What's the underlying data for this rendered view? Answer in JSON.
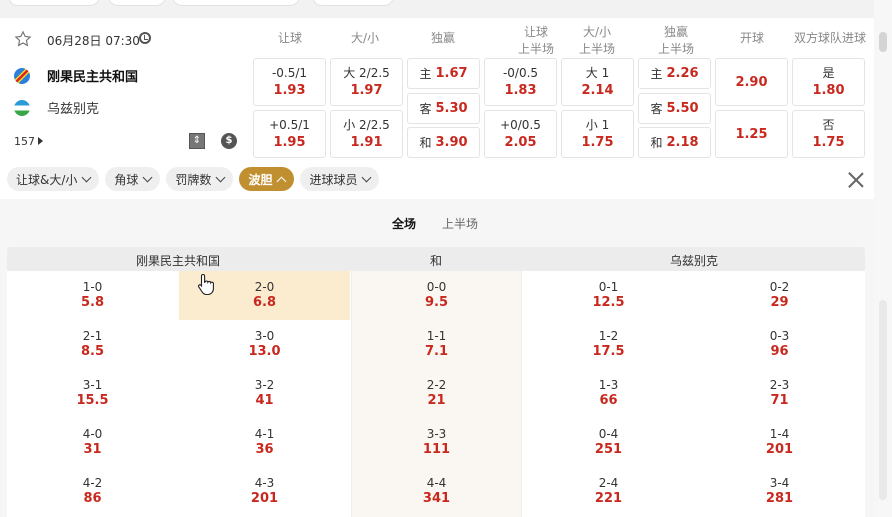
{
  "match": {
    "datetime": "06月28日 07:30",
    "home": "刚果民主共和国",
    "away": "乌兹别克",
    "more_count": "157"
  },
  "icons": {
    "star": "star-outline-icon",
    "clock": "clock-icon",
    "stats": "stats-icon",
    "dollar": "dollar-icon",
    "close": "close-icon"
  },
  "columns": {
    "handicap": "让球",
    "total": "大/小",
    "moneyline": "独赢",
    "handicap_half": "让球\n上半场",
    "total_half": "大/小\n上半场",
    "moneyline_half": "独赢\n上半场",
    "first_goal": "开球",
    "btts": "双方球队进球"
  },
  "odds": {
    "handicap": [
      {
        "line": "-0.5/1",
        "odd": "1.93"
      },
      {
        "line": "+0.5/1",
        "odd": "1.95"
      }
    ],
    "total": [
      {
        "line": "大 2/2.5",
        "odd": "1.97"
      },
      {
        "line": "小 2/2.5",
        "odd": "1.91"
      }
    ],
    "moneyline": [
      {
        "line": "主",
        "odd": "1.67"
      },
      {
        "line": "客",
        "odd": "5.30"
      },
      {
        "line": "和",
        "odd": "3.90"
      }
    ],
    "handicap_half": [
      {
        "line": "-0/0.5",
        "odd": "1.83"
      },
      {
        "line": "+0/0.5",
        "odd": "2.05"
      }
    ],
    "total_half": [
      {
        "line": "大 1",
        "odd": "2.14"
      },
      {
        "line": "小 1",
        "odd": "1.75"
      }
    ],
    "moneyline_half": [
      {
        "line": "主",
        "odd": "2.26"
      },
      {
        "line": "客",
        "odd": "5.50"
      },
      {
        "line": "和",
        "odd": "2.18"
      }
    ],
    "first_goal": [
      {
        "odd": "2.90"
      },
      {
        "odd": "1.25"
      }
    ],
    "btts": [
      {
        "line": "是",
        "odd": "1.80"
      },
      {
        "line": "否",
        "odd": "1.75"
      }
    ]
  },
  "filters": [
    {
      "label": "让球&大/小",
      "active": false
    },
    {
      "label": "角球",
      "active": false
    },
    {
      "label": "罚牌数",
      "active": false
    },
    {
      "label": "波胆",
      "active": true
    },
    {
      "label": "进球球员",
      "active": false
    }
  ],
  "period_tabs": [
    {
      "label": "全场",
      "active": true
    },
    {
      "label": "上半场",
      "active": false
    }
  ],
  "score_headers": {
    "home": "刚果民主共和国",
    "draw": "和",
    "away": "乌兹别克"
  },
  "scores": {
    "home_a": [
      {
        "s": "1-0",
        "o": "5.8"
      },
      {
        "s": "2-1",
        "o": "8.5"
      },
      {
        "s": "3-1",
        "o": "15.5"
      },
      {
        "s": "4-0",
        "o": "31"
      },
      {
        "s": "4-2",
        "o": "86"
      }
    ],
    "home_b": [
      {
        "s": "2-0",
        "o": "6.8"
      },
      {
        "s": "3-0",
        "o": "13.0"
      },
      {
        "s": "3-2",
        "o": "41"
      },
      {
        "s": "4-1",
        "o": "36"
      },
      {
        "s": "4-3",
        "o": "201"
      }
    ],
    "draw": [
      {
        "s": "0-0",
        "o": "9.5"
      },
      {
        "s": "1-1",
        "o": "7.1"
      },
      {
        "s": "2-2",
        "o": "21"
      },
      {
        "s": "3-3",
        "o": "111"
      },
      {
        "s": "4-4",
        "o": "341"
      }
    ],
    "away_a": [
      {
        "s": "0-1",
        "o": "12.5"
      },
      {
        "s": "1-2",
        "o": "17.5"
      },
      {
        "s": "1-3",
        "o": "66"
      },
      {
        "s": "0-4",
        "o": "251"
      },
      {
        "s": "2-4",
        "o": "221"
      }
    ],
    "away_b": [
      {
        "s": "0-2",
        "o": "29"
      },
      {
        "s": "0-3",
        "o": "96"
      },
      {
        "s": "2-3",
        "o": "71"
      },
      {
        "s": "1-4",
        "o": "201"
      },
      {
        "s": "3-4",
        "o": "281"
      }
    ]
  },
  "colors": {
    "odd": "#c8281e",
    "active_chip": "#c09030",
    "highlight": "#fbecd0"
  }
}
